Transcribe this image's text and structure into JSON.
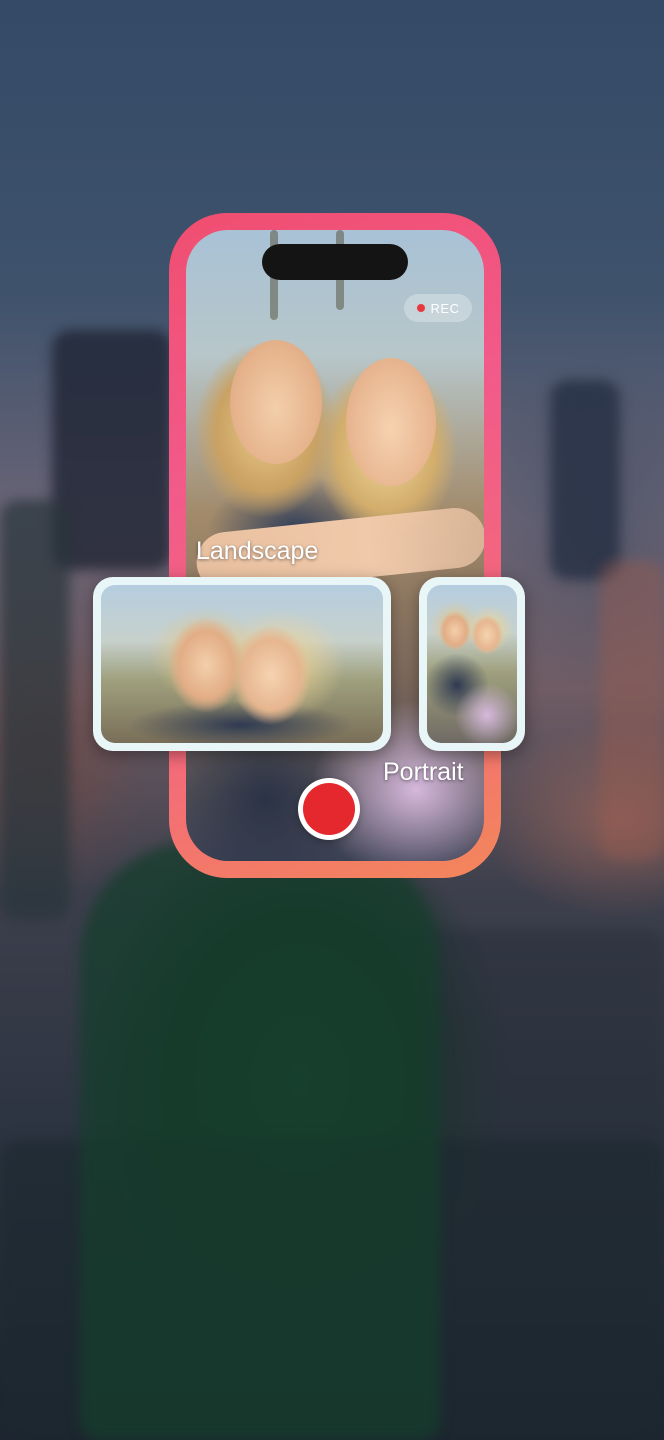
{
  "camera": {
    "rec_label": "REC",
    "record_button": "record"
  },
  "modes": {
    "landscape_label": "Landscape",
    "portrait_label": "Portrait"
  },
  "colors": {
    "frame_gradient_start": "#f04e70",
    "frame_gradient_end": "#f3875a",
    "record_red": "#e5282d",
    "rec_dot": "#e8383d",
    "thumb_border": "#e9f6f7"
  }
}
